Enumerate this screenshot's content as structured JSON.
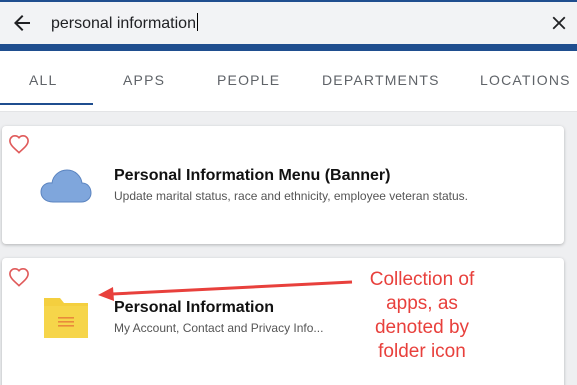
{
  "search": {
    "query": "personal information"
  },
  "tabs": [
    {
      "label": "ALL",
      "active": true
    },
    {
      "label": "APPS"
    },
    {
      "label": "PEOPLE"
    },
    {
      "label": "DEPARTMENTS"
    },
    {
      "label": "LOCATIONS"
    }
  ],
  "results": [
    {
      "title": "Personal Information Menu (Banner)",
      "subtitle": "Update marital status, race and ethnicity, employee veteran status.",
      "icon": "cloud-icon",
      "favorited": false
    },
    {
      "title": "Personal Information",
      "subtitle": "My Account, Contact and Privacy Info...",
      "icon": "folder-icon",
      "favorited": false
    }
  ],
  "annotation": {
    "text": "Collection of apps, as denoted by folder icon"
  },
  "colors": {
    "brand": "#1f4e8f",
    "annotation": "#e8403c",
    "heart": "#e05a5a",
    "cloud": "#7fa6dc",
    "folder": "#f4cf3f"
  }
}
